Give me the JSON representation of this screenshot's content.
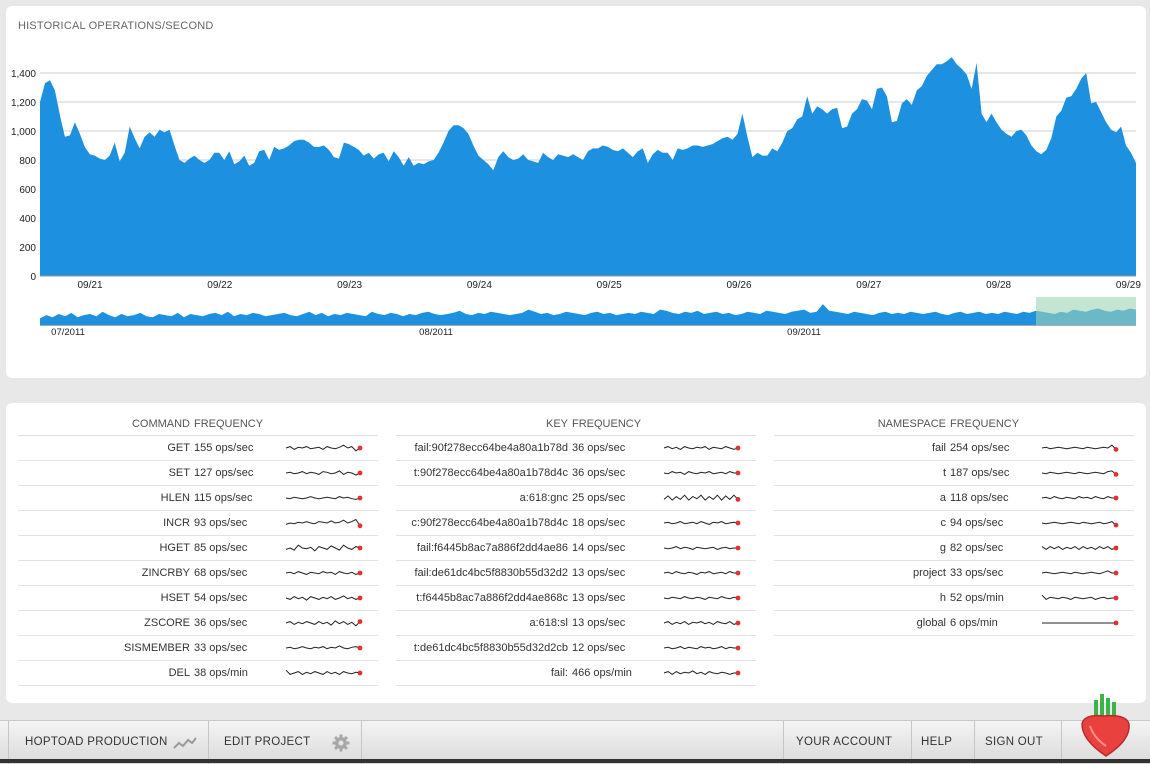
{
  "chart": {
    "title": "HISTORICAL OPERATIONS/SECOND",
    "accent_color": "#1e90e0",
    "selection_color": "#9fd4b5"
  },
  "chart_data": {
    "type": "area",
    "ylim": [
      0,
      1600
    ],
    "yticks": [
      0,
      200,
      400,
      600,
      800,
      "1,000",
      "1,200",
      "1,400"
    ],
    "x_tick_labels": [
      "09/21",
      "09/22",
      "09/23",
      "09/24",
      "09/25",
      "09/26",
      "09/27",
      "09/28",
      "09/29"
    ],
    "overview_tick_labels": [
      "07/2011",
      "08/2011",
      "09/2011"
    ],
    "values": [
      1200,
      1330,
      1350,
      1280,
      1110,
      960,
      970,
      1060,
      980,
      890,
      840,
      830,
      810,
      800,
      830,
      920,
      790,
      850,
      1030,
      950,
      880,
      960,
      990,
      960,
      1010,
      990,
      1010,
      900,
      800,
      780,
      810,
      830,
      800,
      780,
      800,
      850,
      850,
      800,
      860,
      770,
      790,
      830,
      760,
      780,
      860,
      870,
      800,
      890,
      870,
      880,
      900,
      930,
      940,
      940,
      920,
      890,
      890,
      900,
      870,
      820,
      810,
      920,
      910,
      890,
      870,
      830,
      850,
      810,
      840,
      850,
      790,
      860,
      820,
      760,
      820,
      760,
      780,
      770,
      790,
      800,
      850,
      920,
      1000,
      1040,
      1040,
      1020,
      980,
      900,
      830,
      800,
      770,
      730,
      820,
      860,
      820,
      800,
      810,
      840,
      800,
      790,
      780,
      850,
      820,
      800,
      840,
      830,
      820,
      840,
      820,
      800,
      860,
      880,
      880,
      900,
      890,
      870,
      860,
      880,
      850,
      820,
      860,
      880,
      780,
      840,
      870,
      850,
      850,
      800,
      880,
      870,
      880,
      900,
      900,
      890,
      900,
      910,
      930,
      950,
      960,
      940,
      980,
      1120,
      960,
      820,
      850,
      830,
      830,
      880,
      860,
      920,
      1000,
      1020,
      1080,
      1100,
      1240,
      1120,
      1170,
      1150,
      1120,
      1150,
      1160,
      1020,
      1030,
      1120,
      1150,
      1220,
      1210,
      1150,
      1290,
      1300,
      1240,
      1060,
      1070,
      1190,
      1220,
      1180,
      1280,
      1310,
      1380,
      1420,
      1460,
      1460,
      1480,
      1510,
      1460,
      1430,
      1390,
      1290,
      1470,
      1120,
      1060,
      1120,
      1060,
      1010,
      980,
      960,
      1000,
      1010,
      970,
      900,
      860,
      840,
      870,
      950,
      1100,
      1140,
      1230,
      1240,
      1290,
      1360,
      1400,
      1190,
      1200,
      1130,
      1060,
      1010,
      990,
      1030,
      900,
      850,
      780
    ],
    "overview_values": [
      0.3,
      0.45,
      0.35,
      0.5,
      0.4,
      0.55,
      0.35,
      0.45,
      0.5,
      0.4,
      0.6,
      0.45,
      0.35,
      0.5,
      0.4,
      0.45,
      0.55,
      0.4,
      0.35,
      0.5,
      0.45,
      0.4,
      0.55,
      0.35,
      0.5,
      0.45,
      0.4,
      0.5,
      0.55,
      0.45,
      0.6,
      0.4,
      0.5,
      0.45,
      0.55,
      0.5,
      0.4,
      0.45,
      0.5,
      0.55,
      0.45,
      0.4,
      0.5,
      0.6,
      0.45,
      0.55,
      0.4,
      0.5,
      0.45,
      0.55,
      0.5,
      0.45,
      0.4,
      0.6,
      0.5,
      0.45,
      0.55,
      0.5,
      0.4,
      0.5,
      0.45,
      0.55,
      0.6,
      0.5,
      0.45,
      0.5,
      0.55,
      0.65,
      0.5,
      0.45,
      0.55,
      0.5,
      0.6,
      0.55,
      0.5,
      0.45,
      0.5,
      0.55,
      0.7,
      0.6,
      0.5,
      0.55,
      0.45,
      0.5,
      0.6,
      0.55,
      0.5,
      0.45,
      0.55,
      0.6,
      0.5,
      0.55,
      0.45,
      0.5,
      0.55,
      0.5,
      0.6,
      0.55,
      0.5,
      0.7,
      0.65,
      0.55,
      0.5,
      0.6,
      0.55,
      0.65,
      0.5,
      0.55,
      0.6,
      0.5,
      0.55,
      0.45,
      0.5,
      0.6,
      0.55,
      0.5,
      0.65,
      0.6,
      0.55,
      0.5,
      0.6,
      0.65,
      0.7,
      0.55,
      0.6,
      0.95,
      0.65,
      0.6,
      0.55,
      0.5,
      0.6,
      0.55,
      0.5,
      0.45,
      0.55,
      0.6,
      0.5,
      0.55,
      0.5,
      0.6,
      0.55,
      0.5,
      0.55,
      0.6,
      0.5,
      0.45,
      0.55,
      0.6,
      0.5,
      0.55,
      0.6,
      0.5,
      0.55,
      0.5,
      0.6,
      0.55,
      0.5,
      0.6,
      0.55,
      0.65,
      0.6,
      0.55,
      0.5,
      0.6,
      0.55,
      0.7,
      0.65,
      0.6,
      0.7,
      0.75,
      0.65,
      0.6,
      0.7,
      0.65,
      0.75,
      0.7
    ]
  },
  "commands": {
    "header_key": "COMMAND",
    "header_freq": "FREQUENCY",
    "rows": [
      {
        "name": "GET",
        "freq": "155 ops/sec",
        "spark": [
          0.5,
          0.6,
          0.4,
          0.55,
          0.5,
          0.6,
          0.45,
          0.5,
          0.55,
          0.4,
          0.6,
          0.5,
          0.45,
          0.55,
          0.7,
          0.5,
          0.6,
          0.3,
          0.5
        ]
      },
      {
        "name": "SET",
        "freq": "127 ops/sec",
        "spark": [
          0.5,
          0.55,
          0.45,
          0.5,
          0.6,
          0.45,
          0.55,
          0.5,
          0.4,
          0.6,
          0.55,
          0.45,
          0.5,
          0.65,
          0.4,
          0.55,
          0.5,
          0.35,
          0.5
        ]
      },
      {
        "name": "HLEN",
        "freq": "115 ops/sec",
        "spark": [
          0.5,
          0.45,
          0.55,
          0.5,
          0.45,
          0.5,
          0.6,
          0.5,
          0.45,
          0.5,
          0.55,
          0.5,
          0.45,
          0.6,
          0.5,
          0.55,
          0.45,
          0.4,
          0.5
        ]
      },
      {
        "name": "INCR",
        "freq": "93 ops/sec",
        "spark": [
          0.4,
          0.5,
          0.45,
          0.55,
          0.5,
          0.6,
          0.5,
          0.45,
          0.6,
          0.55,
          0.5,
          0.65,
          0.5,
          0.55,
          0.7,
          0.5,
          0.6,
          0.75,
          0.3
        ]
      },
      {
        "name": "HGET",
        "freq": "85 ops/sec",
        "spark": [
          0.4,
          0.5,
          0.35,
          0.7,
          0.5,
          0.45,
          0.55,
          0.3,
          0.6,
          0.5,
          0.4,
          0.65,
          0.5,
          0.35,
          0.7,
          0.5,
          0.4,
          0.6,
          0.5
        ]
      },
      {
        "name": "ZINCRBY",
        "freq": "68 ops/sec",
        "spark": [
          0.5,
          0.55,
          0.45,
          0.6,
          0.5,
          0.4,
          0.55,
          0.5,
          0.45,
          0.6,
          0.5,
          0.55,
          0.4,
          0.6,
          0.5,
          0.45,
          0.55,
          0.4,
          0.5
        ]
      },
      {
        "name": "HSET",
        "freq": "54 ops/sec",
        "spark": [
          0.5,
          0.4,
          0.6,
          0.45,
          0.55,
          0.35,
          0.6,
          0.5,
          0.4,
          0.55,
          0.45,
          0.6,
          0.4,
          0.5,
          0.65,
          0.45,
          0.55,
          0.4,
          0.5
        ]
      },
      {
        "name": "ZSCORE",
        "freq": "36 ops/sec",
        "spark": [
          0.5,
          0.6,
          0.4,
          0.55,
          0.45,
          0.6,
          0.5,
          0.4,
          0.6,
          0.45,
          0.55,
          0.35,
          0.65,
          0.45,
          0.6,
          0.4,
          0.55,
          0.3,
          0.6
        ]
      },
      {
        "name": "SISMEMBER",
        "freq": "33 ops/sec",
        "spark": [
          0.5,
          0.55,
          0.45,
          0.5,
          0.6,
          0.5,
          0.45,
          0.55,
          0.5,
          0.6,
          0.45,
          0.55,
          0.5,
          0.65,
          0.5,
          0.45,
          0.55,
          0.6,
          0.5
        ]
      },
      {
        "name": "DEL",
        "freq": "38 ops/min",
        "spark": [
          0.7,
          0.4,
          0.5,
          0.6,
          0.4,
          0.55,
          0.45,
          0.6,
          0.5,
          0.4,
          0.6,
          0.45,
          0.55,
          0.4,
          0.6,
          0.5,
          0.45,
          0.55,
          0.5
        ]
      }
    ]
  },
  "keys": {
    "header_key": "KEY",
    "header_freq": "FREQUENCY",
    "rows": [
      {
        "name": "fail:90f278ecc64be4a80a1b78d",
        "freq": "36 ops/sec",
        "spark": [
          0.5,
          0.6,
          0.45,
          0.55,
          0.4,
          0.6,
          0.5,
          0.45,
          0.55,
          0.5,
          0.6,
          0.4,
          0.55,
          0.5,
          0.45,
          0.6,
          0.5,
          0.4,
          0.5
        ]
      },
      {
        "name": "t:90f278ecc64be4a80a1b78d4c",
        "freq": "36 ops/sec",
        "spark": [
          0.5,
          0.45,
          0.6,
          0.5,
          0.55,
          0.4,
          0.6,
          0.5,
          0.45,
          0.55,
          0.5,
          0.6,
          0.45,
          0.5,
          0.55,
          0.45,
          0.6,
          0.5,
          0.5
        ]
      },
      {
        "name": "a:618:gnc",
        "freq": "25 ops/sec",
        "spark": [
          0.4,
          0.65,
          0.35,
          0.6,
          0.4,
          0.7,
          0.35,
          0.6,
          0.45,
          0.7,
          0.35,
          0.6,
          0.4,
          0.7,
          0.35,
          0.65,
          0.4,
          0.7,
          0.4
        ]
      },
      {
        "name": "c:90f278ecc64be4a80a1b78d4c",
        "freq": "18 ops/sec",
        "spark": [
          0.5,
          0.55,
          0.45,
          0.5,
          0.6,
          0.45,
          0.5,
          0.55,
          0.45,
          0.6,
          0.5,
          0.4,
          0.55,
          0.5,
          0.6,
          0.45,
          0.5,
          0.55,
          0.5
        ]
      },
      {
        "name": "fail:f6445b8ac7a886f2dd4ae86",
        "freq": "14 ops/sec",
        "spark": [
          0.5,
          0.45,
          0.5,
          0.6,
          0.45,
          0.55,
          0.5,
          0.4,
          0.55,
          0.5,
          0.45,
          0.5,
          0.55,
          0.4,
          0.5,
          0.55,
          0.45,
          0.5,
          0.5
        ]
      },
      {
        "name": "fail:de61dc4bc5f8830b55d32d2",
        "freq": "13 ops/sec",
        "spark": [
          0.5,
          0.55,
          0.45,
          0.6,
          0.5,
          0.45,
          0.55,
          0.5,
          0.4,
          0.55,
          0.5,
          0.6,
          0.45,
          0.5,
          0.55,
          0.45,
          0.6,
          0.5,
          0.5
        ]
      },
      {
        "name": "t:f6445b8ac7a886f2dd4ae868c",
        "freq": "13 ops/sec",
        "spark": [
          0.5,
          0.45,
          0.55,
          0.5,
          0.45,
          0.6,
          0.5,
          0.45,
          0.55,
          0.5,
          0.4,
          0.55,
          0.5,
          0.45,
          0.6,
          0.5,
          0.45,
          0.55,
          0.5
        ]
      },
      {
        "name": "a:618:sl",
        "freq": "13 ops/sec",
        "spark": [
          0.5,
          0.6,
          0.4,
          0.55,
          0.45,
          0.6,
          0.4,
          0.55,
          0.5,
          0.6,
          0.45,
          0.55,
          0.4,
          0.6,
          0.5,
          0.45,
          0.6,
          0.4,
          0.5
        ]
      },
      {
        "name": "t:de61dc4bc5f8830b55d32d2cb",
        "freq": "12 ops/sec",
        "spark": [
          0.5,
          0.55,
          0.45,
          0.5,
          0.6,
          0.45,
          0.55,
          0.5,
          0.45,
          0.6,
          0.5,
          0.55,
          0.45,
          0.5,
          0.6,
          0.45,
          0.55,
          0.5,
          0.5
        ]
      },
      {
        "name": "fail:",
        "freq": "466 ops/min",
        "spark": [
          0.5,
          0.6,
          0.4,
          0.6,
          0.45,
          0.55,
          0.5,
          0.65,
          0.45,
          0.55,
          0.4,
          0.6,
          0.5,
          0.45,
          0.55,
          0.5,
          0.4,
          0.5,
          0.5
        ]
      }
    ]
  },
  "namespaces": {
    "header_key": "NAMESPACE",
    "header_freq": "FREQUENCY",
    "rows": [
      {
        "name": "fail",
        "freq": "254 ops/sec",
        "spark": [
          0.5,
          0.55,
          0.45,
          0.5,
          0.55,
          0.5,
          0.45,
          0.5,
          0.55,
          0.5,
          0.45,
          0.55,
          0.5,
          0.45,
          0.5,
          0.55,
          0.5,
          0.7,
          0.4
        ]
      },
      {
        "name": "t",
        "freq": "187 ops/sec",
        "spark": [
          0.5,
          0.45,
          0.55,
          0.5,
          0.45,
          0.5,
          0.55,
          0.5,
          0.45,
          0.55,
          0.5,
          0.45,
          0.5,
          0.55,
          0.5,
          0.45,
          0.6,
          0.65,
          0.4
        ]
      },
      {
        "name": "a",
        "freq": "118 ops/sec",
        "spark": [
          0.5,
          0.55,
          0.45,
          0.6,
          0.5,
          0.45,
          0.55,
          0.5,
          0.45,
          0.6,
          0.5,
          0.55,
          0.45,
          0.6,
          0.5,
          0.45,
          0.6,
          0.5,
          0.5
        ]
      },
      {
        "name": "c",
        "freq": "94 ops/sec",
        "spark": [
          0.5,
          0.45,
          0.5,
          0.55,
          0.5,
          0.45,
          0.5,
          0.55,
          0.5,
          0.45,
          0.55,
          0.5,
          0.45,
          0.5,
          0.55,
          0.45,
          0.5,
          0.6,
          0.35
        ]
      },
      {
        "name": "g",
        "freq": "82 ops/sec",
        "spark": [
          0.6,
          0.4,
          0.6,
          0.45,
          0.6,
          0.4,
          0.55,
          0.45,
          0.6,
          0.4,
          0.6,
          0.45,
          0.55,
          0.4,
          0.6,
          0.45,
          0.6,
          0.4,
          0.5
        ]
      },
      {
        "name": "project",
        "freq": "33 ops/sec",
        "spark": [
          0.5,
          0.55,
          0.5,
          0.45,
          0.5,
          0.55,
          0.5,
          0.45,
          0.55,
          0.5,
          0.45,
          0.5,
          0.55,
          0.5,
          0.45,
          0.55,
          0.65,
          0.5,
          0.5
        ]
      },
      {
        "name": "h",
        "freq": "52 ops/min",
        "spark": [
          0.7,
          0.4,
          0.55,
          0.5,
          0.45,
          0.55,
          0.5,
          0.4,
          0.55,
          0.5,
          0.45,
          0.5,
          0.55,
          0.4,
          0.5,
          0.55,
          0.45,
          0.5,
          0.5
        ]
      },
      {
        "name": "global",
        "freq": "6 ops/min",
        "spark": [
          0.5,
          0.5,
          0.5,
          0.5,
          0.5,
          0.5,
          0.5,
          0.5,
          0.5,
          0.5,
          0.5,
          0.5,
          0.5,
          0.5,
          0.5,
          0.5,
          0.5,
          0.5,
          0.5
        ]
      }
    ]
  },
  "footer": {
    "project_label": "HOPTOAD PRODUCTION",
    "project_icon": "activity-chart-icon",
    "edit_label": "EDIT PROJECT",
    "edit_icon": "gear-icon",
    "account_label": "YOUR ACCOUNT",
    "help_label": "HELP",
    "signout_label": "SIGN OUT",
    "logo_icon": "radish-logo-icon"
  }
}
